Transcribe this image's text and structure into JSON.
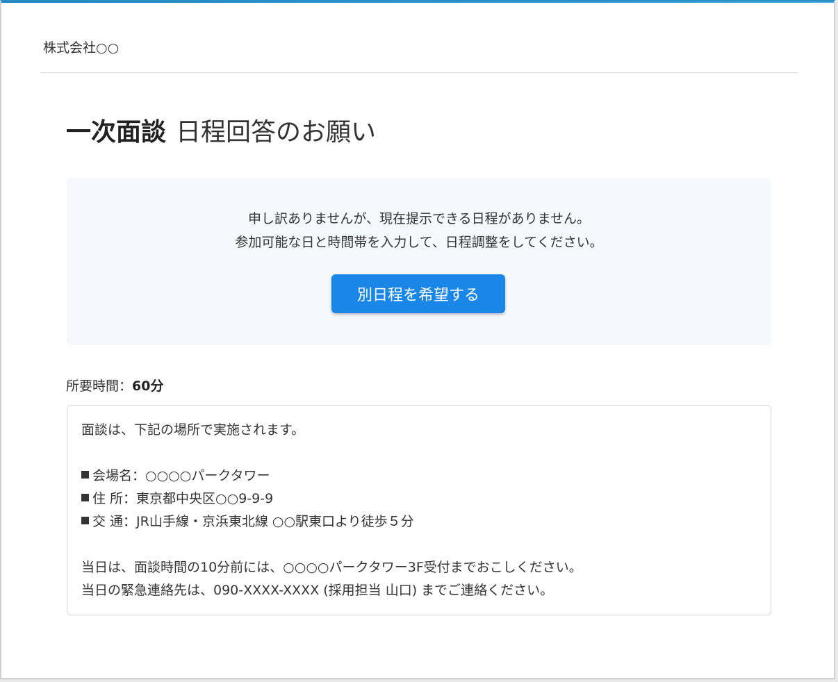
{
  "header": {
    "company_name": "株式会社○○"
  },
  "page": {
    "title_bold": "一次面談",
    "title_light": "日程回答のお願い"
  },
  "notice": {
    "line1": "申し訳ありませんが、現在提示できる日程がありません。",
    "line2": "参加可能な日と時間帯を入力して、日程調整をしてください。",
    "button_label": "別日程を希望する"
  },
  "duration": {
    "label": "所要時間：",
    "value": "60分"
  },
  "info": {
    "intro": "面談は、下記の場所で実施されます。",
    "venue": "会場名：○○○○パークタワー",
    "address": "住 所：東京都中央区○○9-9-9",
    "access": "交 通：JR山手線・京浜東北線 ○○駅東口より徒歩５分",
    "arrival": "当日は、面談時間の10分前には、○○○○パークタワー3F受付までおこしください。",
    "contact": "当日の緊急連絡先は、090-XXXX-XXXX (採用担当 山口) までご連絡ください。"
  },
  "colors": {
    "accent": "#1a86e8",
    "notice_bg": "#f5f9fd"
  }
}
